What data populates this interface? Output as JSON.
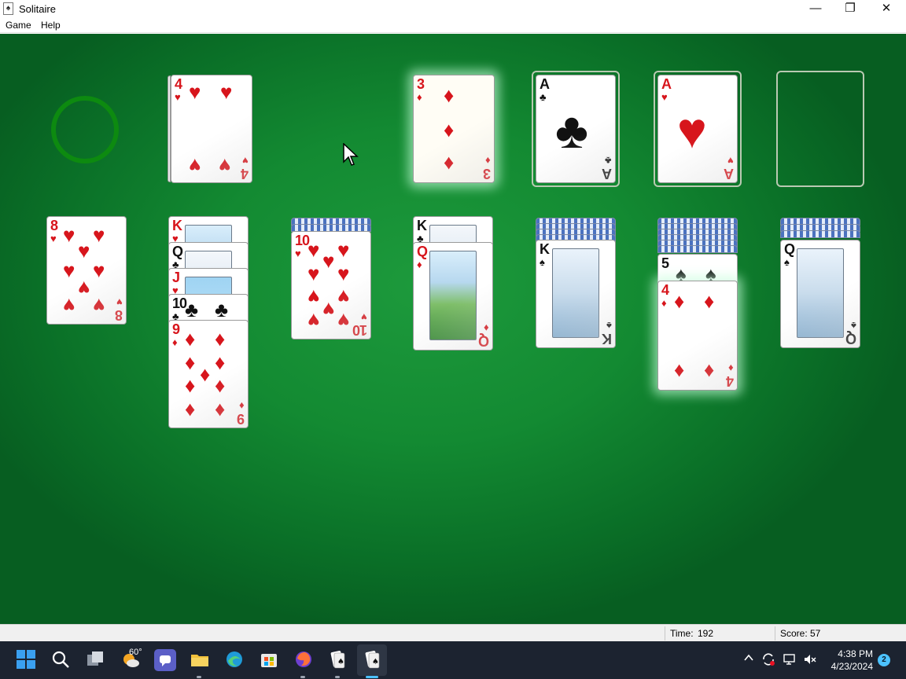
{
  "window": {
    "title": "Solitaire",
    "controls": {
      "minimize": "—",
      "restore": "❐",
      "close": "✕"
    }
  },
  "menu": [
    "Game",
    "Help"
  ],
  "stock": {
    "state": "empty",
    "redeal_icon": "green-ring"
  },
  "waste": {
    "top": {
      "rank": "4",
      "suit": "♥",
      "color": "red"
    }
  },
  "foundations": [
    {
      "rank": "3",
      "suit": "♦",
      "color": "red",
      "highlighted": true
    },
    {
      "rank": "A",
      "suit": "♣",
      "color": "black"
    },
    {
      "rank": "A",
      "suit": "♥",
      "color": "red"
    },
    {
      "rank": "",
      "suit": "",
      "state": "empty"
    }
  ],
  "tableau": [
    {
      "face_down": 0,
      "cards": [
        {
          "rank": "8",
          "suit": "♥"
        }
      ]
    },
    {
      "face_down": 0,
      "cards": [
        {
          "rank": "K",
          "suit": "♥"
        },
        {
          "rank": "Q",
          "suit": "♣"
        },
        {
          "rank": "J",
          "suit": "♥"
        },
        {
          "rank": "10",
          "suit": "♣"
        },
        {
          "rank": "9",
          "suit": "♦"
        }
      ]
    },
    {
      "face_down": 2,
      "cards": [
        {
          "rank": "10",
          "suit": "♥"
        }
      ]
    },
    {
      "face_down": 0,
      "cards": [
        {
          "rank": "K",
          "suit": "♣"
        },
        {
          "rank": "Q",
          "suit": "♦"
        }
      ]
    },
    {
      "face_down": 4,
      "cards": [
        {
          "rank": "K",
          "suit": "♠"
        }
      ]
    },
    {
      "face_down": 6,
      "cards": [
        {
          "rank": "5",
          "suit": "♠"
        },
        {
          "rank": "4",
          "suit": "♦",
          "highlighted": true
        }
      ]
    },
    {
      "face_down": 3,
      "cards": [
        {
          "rank": "Q",
          "suit": "♠"
        }
      ]
    }
  ],
  "status": {
    "time_label": "Time:",
    "time_value": "192",
    "score_label": "Score:",
    "score_value": "57"
  },
  "taskbar": {
    "weather": "60°",
    "clock_time": "4:38 PM",
    "clock_date": "4/23/2024",
    "notification_count": "2"
  },
  "colors": {
    "felt": "#138a32",
    "red_suit": "#d7151c",
    "ring": "#0d8a10"
  }
}
